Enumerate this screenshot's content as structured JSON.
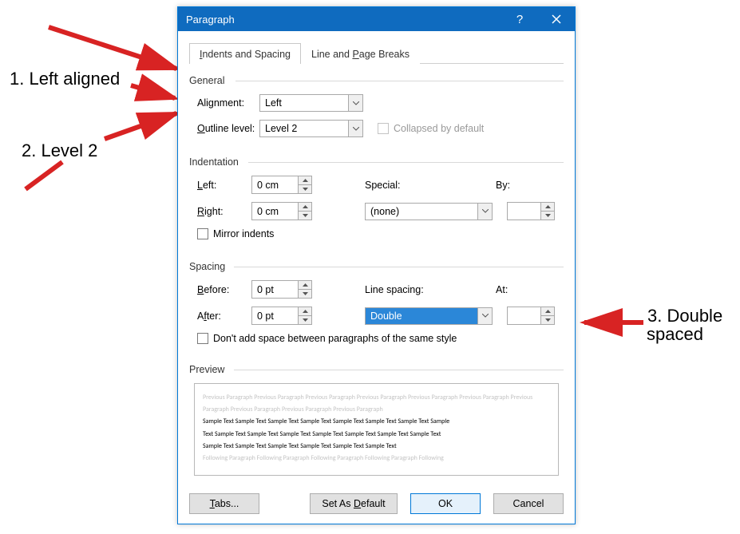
{
  "annotations": {
    "a1": "1. Left aligned",
    "a2": "2. Level 2",
    "a3_l1": "3. Double",
    "a3_l2": "spaced"
  },
  "titlebar": {
    "title": "Paragraph"
  },
  "tabs": {
    "indents_pre": "",
    "indents_u": "I",
    "indents_post": "ndents and Spacing",
    "breaks_pre": "Line and ",
    "breaks_u": "P",
    "breaks_post": "age Breaks"
  },
  "general": {
    "legend": "General",
    "alignment_label_pre": "Ali",
    "alignment_label_u": "g",
    "alignment_label_post": "nment:",
    "alignment_value": "Left",
    "outline_label_pre": "",
    "outline_label_u": "O",
    "outline_label_post": "utline level:",
    "outline_value": "Level 2",
    "collapsed_label": "Collapsed by default"
  },
  "indent": {
    "legend": "Indentation",
    "left_pre": "",
    "left_u": "L",
    "left_post": "eft:",
    "left_value": "0 cm",
    "right_pre": "",
    "right_u": "R",
    "right_post": "ight:",
    "right_value": "0 cm",
    "special_pre": "",
    "special_u": "S",
    "special_post": "pecial:",
    "special_value": "(none)",
    "by_pre": "B",
    "by_u": "y",
    "by_post": ":",
    "by_value": "",
    "mirror_pre": "",
    "mirror_u": "M",
    "mirror_post": "irror indents"
  },
  "spacing": {
    "legend": "Spacing",
    "before_pre": "",
    "before_u": "B",
    "before_post": "efore:",
    "before_value": "0 pt",
    "after_pre": "A",
    "after_u": "f",
    "after_post": "ter:",
    "after_value": "0 pt",
    "line_pre": "Li",
    "line_u": "n",
    "line_post": "e spacing:",
    "line_value": "Double",
    "at_pre": "",
    "at_u": "A",
    "at_post": "t:",
    "at_value": "",
    "nospace_label": "Don't add space between paragraphs of the same style"
  },
  "preview": {
    "legend": "Preview",
    "ghost1": "Previous Paragraph Previous Paragraph Previous Paragraph Previous Paragraph Previous Paragraph Previous Paragraph Previous Paragraph Previous Paragraph Previous Paragraph Previous Paragraph",
    "sample1": "Sample Text Sample Text Sample Text Sample Text Sample Text Sample Text Sample Text Sample",
    "sample2": "Text Sample Text Sample Text Sample Text Sample Text Sample Text Sample Text Sample Text",
    "sample3": "Sample Text Sample Text Sample Text Sample Text Sample Text Sample Text",
    "ghost2": "Following Paragraph Following Paragraph Following Paragraph Following Paragraph Following"
  },
  "buttons": {
    "tabs_pre": "",
    "tabs_u": "T",
    "tabs_post": "abs...",
    "default_pre": "Set As ",
    "default_u": "D",
    "default_post": "efault",
    "ok": "OK",
    "cancel": "Cancel"
  }
}
